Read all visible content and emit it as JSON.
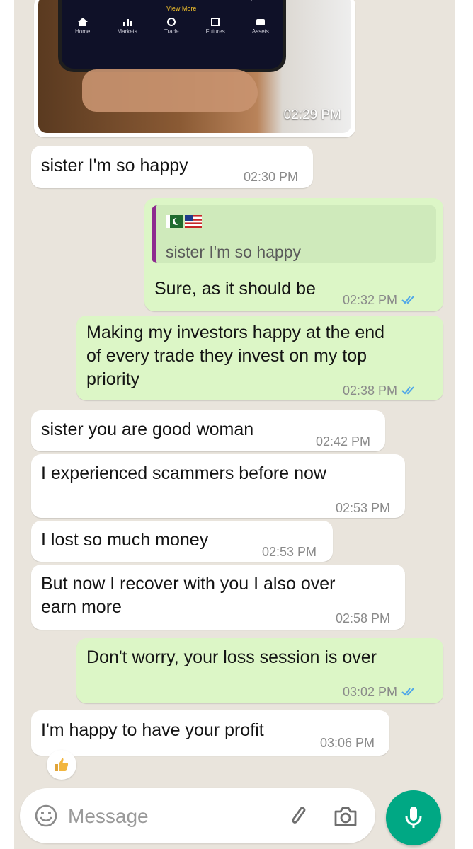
{
  "colors": {
    "incoming": "#ffffff",
    "outgoing": "#dcf6c6",
    "accent": "#00a884",
    "read_ticks": "#4fa6e8",
    "quote_bar": "#8d2b8f"
  },
  "media": {
    "time": "02:29 PM",
    "app_nav": {
      "top_label": "View More",
      "items": [
        "Home",
        "Markets",
        "Trade",
        "Futures",
        "Assets"
      ]
    }
  },
  "messages": [
    {
      "id": "m1",
      "dir": "in",
      "text": "sister I'm so happy",
      "time": "02:30 PM"
    },
    {
      "id": "m2",
      "dir": "out",
      "quote": {
        "author_icons": [
          "flag-pk-icon",
          "flag-us-icon"
        ],
        "text": "sister I'm so happy"
      },
      "text": "Sure, as it should be",
      "time": "02:32 PM",
      "read": true
    },
    {
      "id": "m3",
      "dir": "out",
      "text": "Making my investors happy at the end\nof every trade they invest on my top\npriority",
      "time": "02:38 PM",
      "read": true
    },
    {
      "id": "m4",
      "dir": "in",
      "text": "sister you are good woman",
      "time": "02:42 PM"
    },
    {
      "id": "m5",
      "dir": "in",
      "text": "I experienced scammers before now",
      "time": "02:53 PM"
    },
    {
      "id": "m6",
      "dir": "in",
      "text": "I lost so much money",
      "time": "02:53 PM"
    },
    {
      "id": "m7",
      "dir": "in",
      "text": "But now I recover with you I also over\nearn more",
      "time": "02:58 PM"
    },
    {
      "id": "m8",
      "dir": "out",
      "text": "Don't worry, your loss session is over",
      "time": "03:02 PM",
      "read": true
    },
    {
      "id": "m9",
      "dir": "in",
      "text": "I'm happy to have your profit",
      "time": "03:06 PM",
      "reaction": "thumbs-up-icon"
    }
  ],
  "composer": {
    "placeholder": "Message",
    "icons": [
      "emoji-icon",
      "paperclip-icon",
      "camera-icon",
      "microphone-icon"
    ]
  }
}
